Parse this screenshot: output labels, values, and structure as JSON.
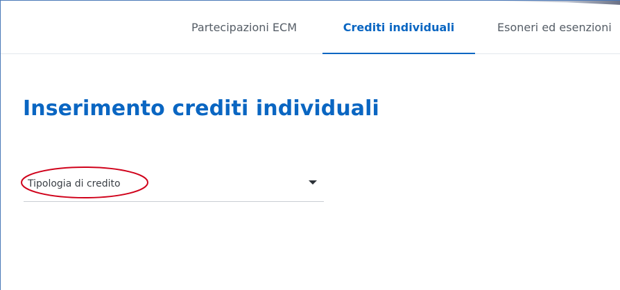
{
  "tabs": [
    {
      "label": "Partecipazioni ECM",
      "active": false
    },
    {
      "label": "Crediti individuali",
      "active": true
    },
    {
      "label": "Esoneri ed esenzioni",
      "active": false
    }
  ],
  "page": {
    "title": "Inserimento crediti individuali"
  },
  "form": {
    "select_label": "Tipologia di credito",
    "select_icon": "caret-down-icon"
  },
  "colors": {
    "accent": "#0a66c2",
    "annotation": "#d0021b",
    "tab_text": "#555d66"
  }
}
